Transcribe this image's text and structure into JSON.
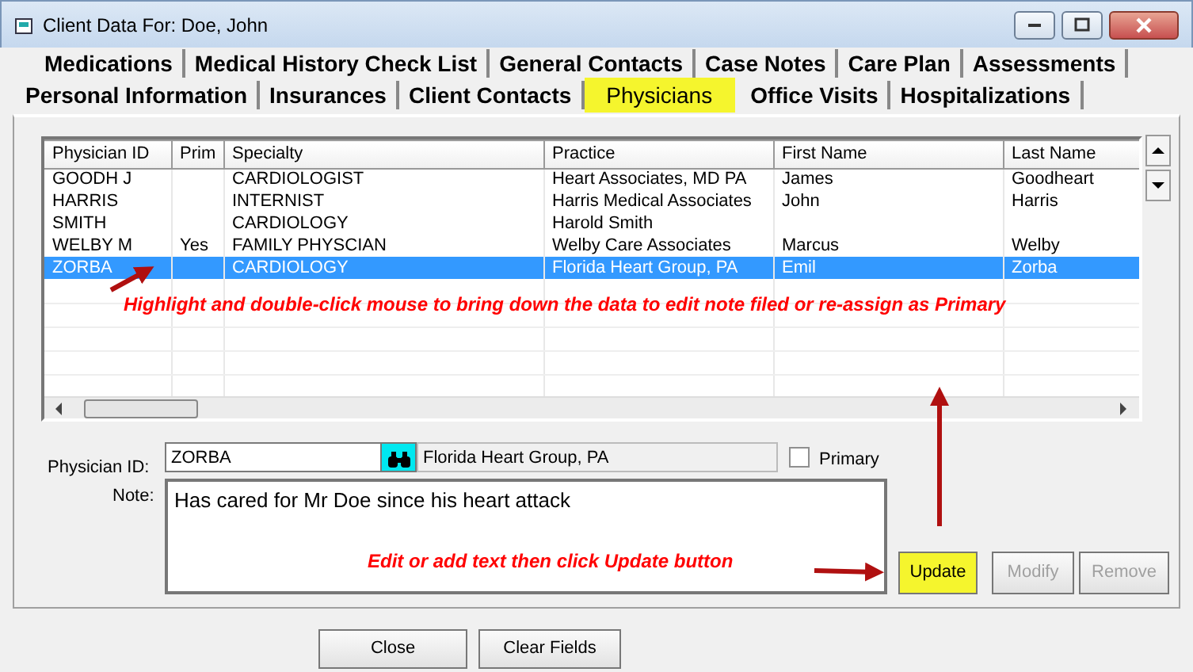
{
  "window": {
    "title": "Client Data For: Doe, John"
  },
  "tab_rows": [
    [
      {
        "label": "Medications",
        "selected": false
      },
      {
        "label": "Medical History Check List",
        "selected": false
      },
      {
        "label": "General Contacts",
        "selected": false
      },
      {
        "label": "Case Notes",
        "selected": false
      },
      {
        "label": "Care Plan",
        "selected": false
      },
      {
        "label": "Assessments",
        "selected": false
      }
    ],
    [
      {
        "label": "Personal Information",
        "selected": false
      },
      {
        "label": "Insurances",
        "selected": false
      },
      {
        "label": "Client Contacts",
        "selected": false
      },
      {
        "label": "Physicians",
        "selected": true
      },
      {
        "label": "Office Visits",
        "selected": false
      },
      {
        "label": "Hospitalizations",
        "selected": false
      }
    ]
  ],
  "grid": {
    "columns": [
      "Physician ID",
      "Prim",
      "Specialty",
      "Practice",
      "First Name",
      "Last Name"
    ],
    "rows": [
      {
        "cells": [
          "GOODH J",
          "",
          "CARDIOLOGIST",
          "Heart Associates, MD PA",
          "James",
          "Goodheart"
        ],
        "selected": false
      },
      {
        "cells": [
          "HARRIS",
          "",
          "INTERNIST",
          "Harris Medical Associates",
          "John",
          "Harris"
        ],
        "selected": false
      },
      {
        "cells": [
          "SMITH",
          "",
          "CARDIOLOGY",
          "Harold Smith",
          "",
          ""
        ],
        "selected": false
      },
      {
        "cells": [
          "WELBY M",
          "Yes",
          "FAMILY PHYSCIAN",
          "Welby Care Associates",
          "Marcus",
          "Welby"
        ],
        "selected": false
      },
      {
        "cells": [
          "ZORBA",
          "",
          "CARDIOLOGY",
          "Florida Heart Group, PA",
          "Emil",
          "Zorba"
        ],
        "selected": true
      }
    ],
    "annotation": "Highlight and double-click mouse to bring down the data to edit note filed or re-assign as Primary"
  },
  "form": {
    "id_label": "Physician ID:",
    "id_value": "ZORBA",
    "practice_value": "Florida Heart Group, PA",
    "primary": {
      "label": "Primary",
      "checked": false
    },
    "note_label": "Note:",
    "note_value": "Has cared for Mr Doe since his heart attack",
    "annotation": "Edit or add text then click Update button"
  },
  "buttons": [
    {
      "label": "Update",
      "disabled": false,
      "highlighted": true
    },
    {
      "label": "Modify",
      "disabled": true,
      "highlighted": false
    },
    {
      "label": "Remove",
      "disabled": true,
      "highlighted": false
    }
  ],
  "footer_buttons": [
    {
      "label": "Close"
    },
    {
      "label": "Clear Fields"
    }
  ]
}
